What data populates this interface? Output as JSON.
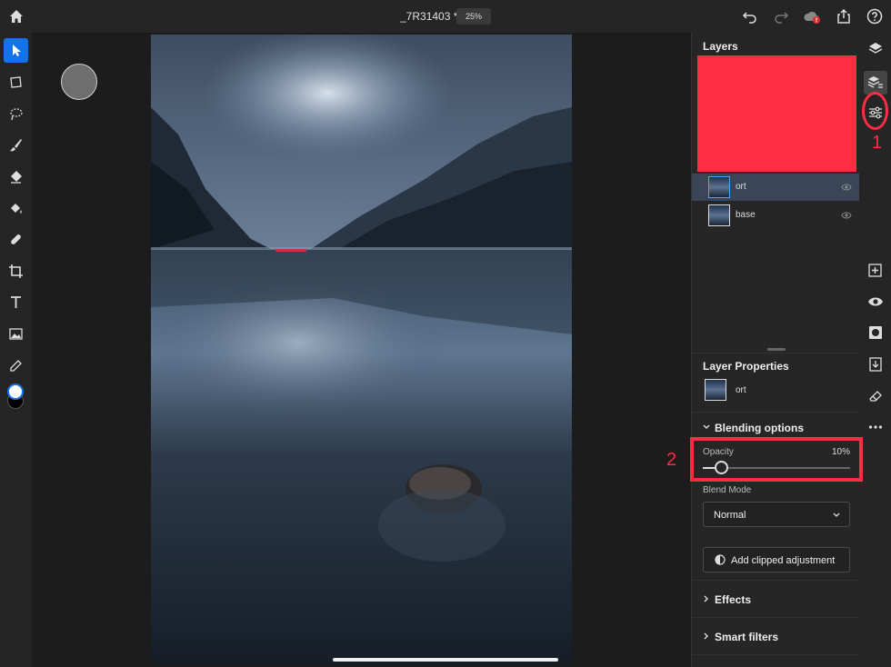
{
  "document": {
    "title": "_7R31403 *",
    "zoom": "25%"
  },
  "layers_panel": {
    "title": "Layers",
    "layers": [
      {
        "name": "ort",
        "selected": true
      },
      {
        "name": "base",
        "selected": false
      }
    ]
  },
  "layer_properties": {
    "title": "Layer Properties",
    "layer_name": "ort",
    "blending_options": {
      "title": "Blending options",
      "opacity_label": "Opacity",
      "opacity_value": "10%",
      "opacity_fraction": 0.1,
      "blend_mode_label": "Blend Mode",
      "blend_mode": "Normal"
    },
    "clipped_adjustment_label": "Add clipped adjustment",
    "effects_label": "Effects",
    "smart_filters_label": "Smart filters"
  },
  "annotations": {
    "step1": "1",
    "step2": "2"
  },
  "colors": {
    "accent": "#1473e6",
    "annotation": "#ff2d43",
    "selected_layer": "#3a4657"
  }
}
